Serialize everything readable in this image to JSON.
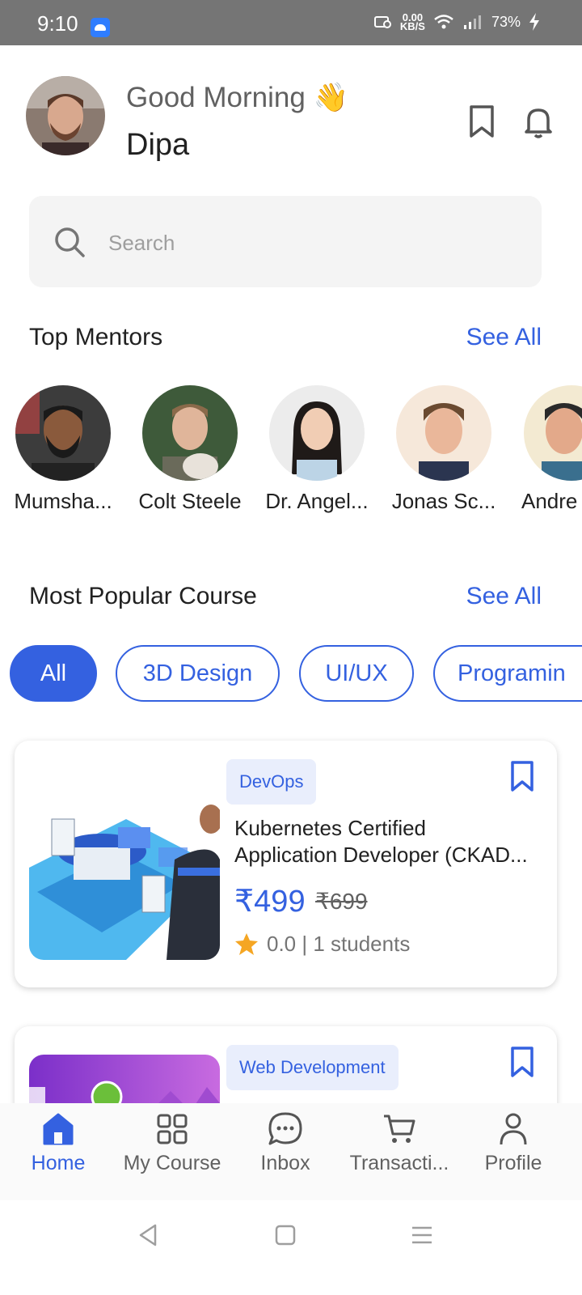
{
  "status_bar": {
    "time": "9:10",
    "speed_value": "0.00",
    "speed_unit": "KB/S",
    "battery": "73%"
  },
  "header": {
    "greeting": "Good Morning 👋",
    "user_name": "Dipa"
  },
  "search": {
    "placeholder": "Search"
  },
  "mentors_section": {
    "title": "Top Mentors",
    "see_all": "See All",
    "mentors": [
      {
        "name": "Mumsha..."
      },
      {
        "name": "Colt Steele"
      },
      {
        "name": "Dr. Angel..."
      },
      {
        "name": "Jonas Sc..."
      },
      {
        "name": "Andre"
      }
    ]
  },
  "courses_section": {
    "title": "Most Popular Course",
    "see_all": "See All",
    "chips": [
      "All",
      "3D Design",
      "UI/UX",
      "Programin"
    ]
  },
  "courses": [
    {
      "category": "DevOps",
      "title_line1": "Kubernetes Certified",
      "title_line2": "Application Developer (CKAD...",
      "price": "₹499",
      "original_price": "₹699",
      "rating": "0.0 | 1 students"
    },
    {
      "category": "Web Development"
    }
  ],
  "bottom_nav": {
    "items": [
      {
        "label": "Home",
        "icon": "home-icon"
      },
      {
        "label": "My Course",
        "icon": "grid-icon"
      },
      {
        "label": "Inbox",
        "icon": "chat-icon"
      },
      {
        "label": "Transacti...",
        "icon": "cart-icon"
      },
      {
        "label": "Profile",
        "icon": "person-icon"
      }
    ]
  },
  "colors": {
    "accent": "#3461e0",
    "status_bar": "#757575",
    "tag_bg": "#e9eefc"
  }
}
